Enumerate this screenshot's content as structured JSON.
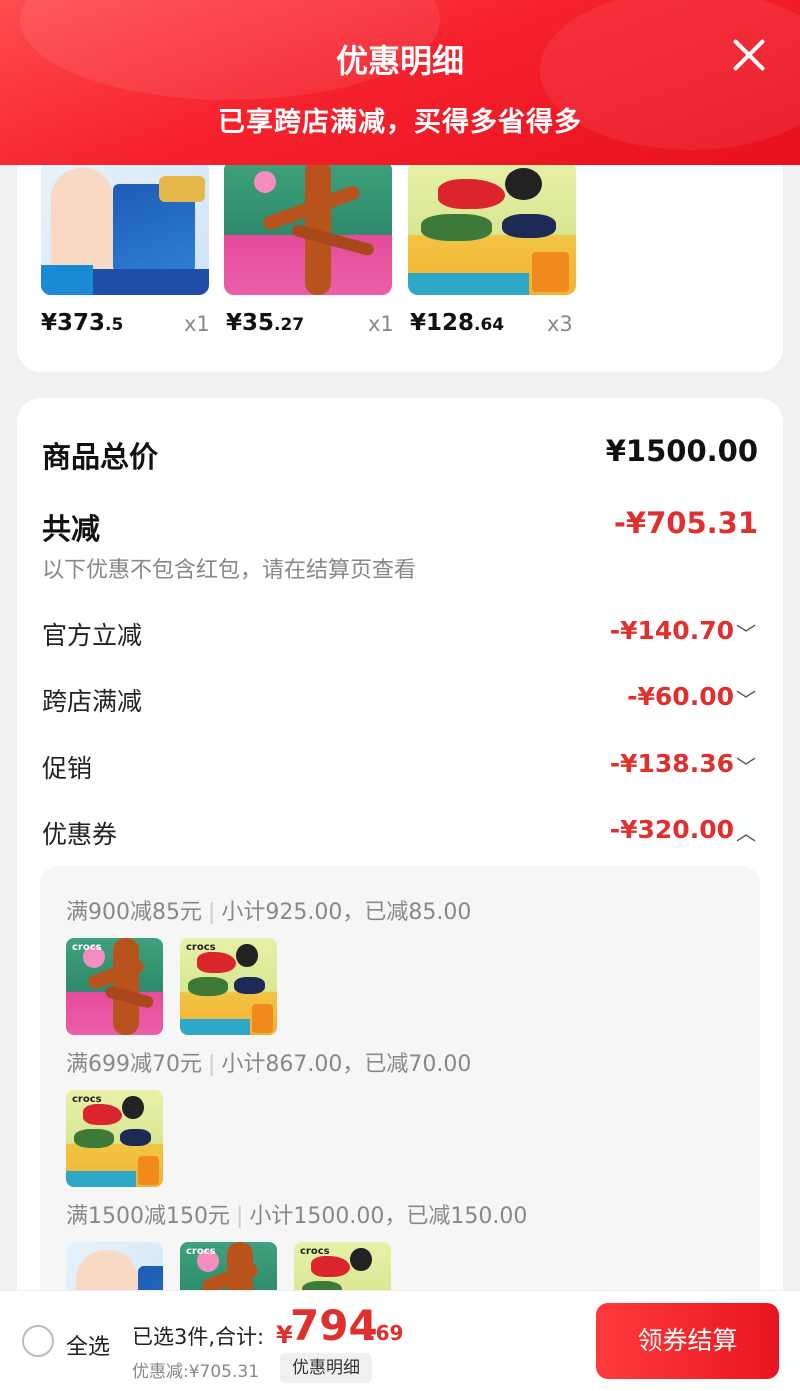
{
  "header": {
    "title": "优惠明细",
    "subtitle": "已享跨店满减，买得多省得多",
    "close_icon": "close-icon"
  },
  "products": [
    {
      "price_main": "¥373",
      "price_dec": ".5",
      "qty": "x1",
      "image": "milk-powder-product"
    },
    {
      "price_main": "¥35",
      "price_dec": ".27",
      "qty": "x1",
      "image": "crocs-tree-product"
    },
    {
      "price_main": "¥128",
      "price_dec": ".64",
      "qty": "x3",
      "image": "crocs-shoes-product"
    }
  ],
  "summary": {
    "total_label": "商品总价",
    "total_value": "¥1500.00",
    "reduced_label": "共减",
    "reduced_value": "-¥705.31",
    "note": "以下优惠不包含红包，请在结算页查看",
    "items": [
      {
        "label": "官方立减",
        "value": "-¥140.70",
        "chevron": "chevron-down-icon"
      },
      {
        "label": "跨店满减",
        "value": "-¥60.00",
        "chevron": "chevron-down-icon"
      },
      {
        "label": "促销",
        "value": "-¥138.36",
        "chevron": "chevron-down-icon"
      },
      {
        "label": "优惠券",
        "value": "-¥320.00",
        "chevron": "chevron-up-icon"
      }
    ]
  },
  "coupons": [
    {
      "rule": "满900减85元",
      "detail": "小计925.00，已减85.00"
    },
    {
      "rule": "满699减70元",
      "detail": "小计867.00，已减70.00"
    },
    {
      "rule": "满1500减150元",
      "detail": "小计1500.00，已减150.00"
    }
  ],
  "bottom": {
    "select_all": "全选",
    "selected_text": "已选3件,合计:",
    "total_symbol": "¥",
    "total_int": "794",
    "total_dec": ".69",
    "discount_text": "优惠减:¥705.31",
    "detail_button": "优惠明细",
    "checkout_button": "领券结算"
  },
  "colors": {
    "accent_red": "#e0302d",
    "header_red": "#f5222d"
  }
}
